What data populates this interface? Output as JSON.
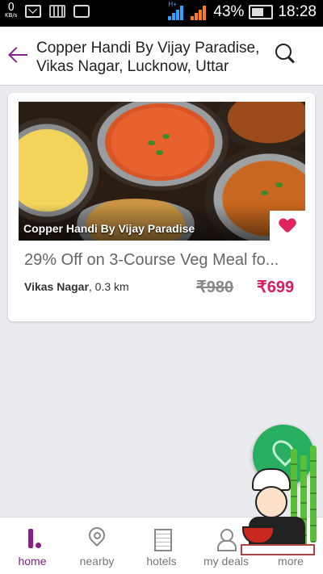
{
  "status_bar": {
    "net_speed": "0",
    "net_unit": "KB/s",
    "network_type": "H+",
    "sim2": "2",
    "battery": "43%",
    "time": "18:28"
  },
  "header": {
    "title": "Copper Handi By Vijay Paradise, Vikas Nagar, Lucknow, Uttar",
    "back_icon": "arrow-left-icon",
    "search_icon": "search-icon",
    "accent": "#8a1f8a"
  },
  "deal": {
    "photo_caption": "Copper Handi By Vijay Paradise",
    "title": "29% Off on 3-Course Veg Meal fo...",
    "location": "Vikas Nagar",
    "distance": ", 0.3 km",
    "price_old": "₹980",
    "price_new": "₹699",
    "price_color": "#d81b60"
  },
  "fab": {
    "icon": "map-pin-icon",
    "color": "#27ae60"
  },
  "bottom_nav": {
    "items": [
      {
        "label": "home",
        "icon": "home-icon",
        "active": true
      },
      {
        "label": "nearby",
        "icon": "location-icon",
        "active": false
      },
      {
        "label": "hotels",
        "icon": "hotel-icon",
        "active": false
      },
      {
        "label": "my deals",
        "icon": "deals-icon",
        "active": false
      },
      {
        "label": "more",
        "icon": "more-icon",
        "active": false
      }
    ]
  }
}
